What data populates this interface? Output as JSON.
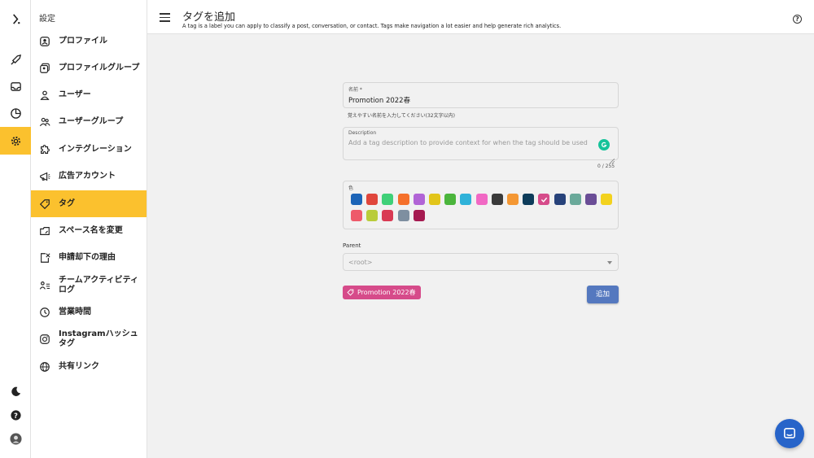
{
  "header": {
    "title": "タグを追加",
    "subtitle": "A tag is a label you can apply to classify a post, conversation, or contact. Tags make navigation a lot easier and help generate rich analytics."
  },
  "rail": {
    "items": [
      "logo-icon",
      "rocket-icon",
      "inbox-icon",
      "pie-chart-icon",
      "gear-icon"
    ],
    "bottom": [
      "dark-mode-icon",
      "help-icon",
      "avatar"
    ],
    "active": "gear-icon"
  },
  "sidebar": {
    "title": "設定",
    "items": [
      {
        "label": "プロファイル",
        "icon": "profile-icon"
      },
      {
        "label": "プロファイルグループ",
        "icon": "profile-group-icon"
      },
      {
        "label": "ユーザー",
        "icon": "user-icon"
      },
      {
        "label": "ユーザーグループ",
        "icon": "user-group-icon"
      },
      {
        "label": "インテグレーション",
        "icon": "puzzle-icon"
      },
      {
        "label": "広告アカウント",
        "icon": "megaphone-icon"
      },
      {
        "label": "タグ",
        "icon": "tag-icon",
        "active": true
      },
      {
        "label": "スペース名を変更",
        "icon": "rename-icon"
      },
      {
        "label": "申請却下の理由",
        "icon": "reject-icon"
      },
      {
        "label": "チームアクティビティログ",
        "icon": "activity-icon"
      },
      {
        "label": "営業時間",
        "icon": "clock-icon"
      },
      {
        "label": "Instagramハッシュタグ",
        "icon": "instagram-icon"
      },
      {
        "label": "共有リンク",
        "icon": "globe-icon"
      }
    ]
  },
  "form": {
    "name_label": "名前 *",
    "name_value": "Promotion 2022春",
    "name_helper": "覚えやすい名前を入力してください(32文字以内)",
    "description_label": "Description",
    "description_placeholder": "Add a tag description to provide context for when the tag should be used",
    "description_counter": "0 / 255",
    "color_label": "色",
    "colors": [
      "#1c64b7",
      "#e0463c",
      "#3fd078",
      "#f5702b",
      "#b164d6",
      "#e2c51a",
      "#4bb53c",
      "#2fb2d9",
      "#f168c4",
      "#3a3a3a",
      "#f49733",
      "#0d3c5a",
      "#d64b8a",
      "#27427a",
      "#6aa99a",
      "#6a4d96",
      "#f3d21e",
      "#ee5a6a",
      "#b9cc3a",
      "#d93a53",
      "#7e8fa0",
      "#a51a50"
    ],
    "selected_color": "#d64b8a",
    "parent_label": "Parent",
    "parent_value": "<root>",
    "preview_tag": "Promotion 2022春",
    "submit_label": "追加"
  }
}
